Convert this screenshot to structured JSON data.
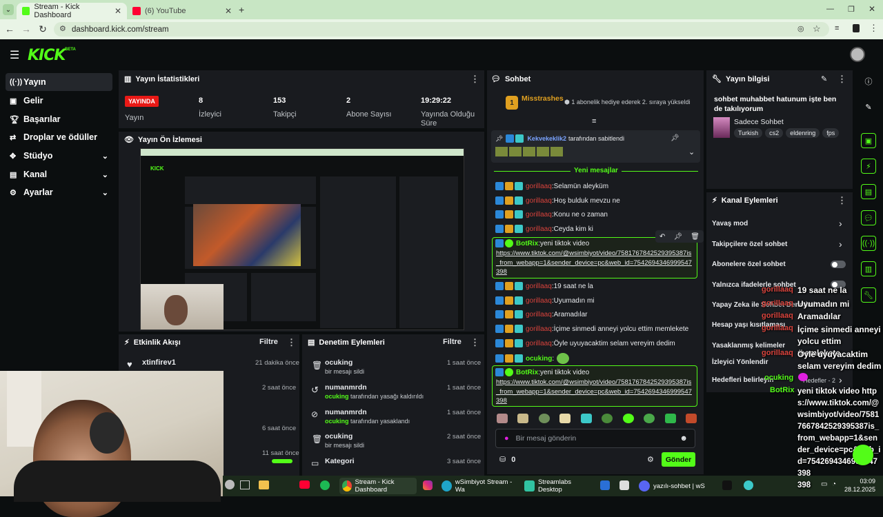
{
  "browser": {
    "tabs": [
      {
        "title": "Stream - Kick Dashboard",
        "active": true
      },
      {
        "title": "(6) YouTube",
        "active": false
      }
    ],
    "url": "dashboard.kick.com/stream"
  },
  "kick": {
    "logo": "KICK",
    "beta": "BETA"
  },
  "nav": [
    {
      "label": "Yayın",
      "icon": "broadcast-icon",
      "active": true
    },
    {
      "label": "Gelir",
      "icon": "money-icon"
    },
    {
      "label": "Başarılar",
      "icon": "trophy-icon"
    },
    {
      "label": "Droplar ve ödüller",
      "icon": "gift-icon"
    },
    {
      "label": "Stüdyo",
      "icon": "studio-icon",
      "expand": true
    },
    {
      "label": "Kanal",
      "icon": "channel-icon",
      "expand": true
    },
    {
      "label": "Ayarlar",
      "icon": "settings-icon",
      "expand": true
    }
  ],
  "stats": {
    "title": "Yayın İstatistikleri",
    "live_badge": "YAYINDA",
    "live_label": "Yayın",
    "items": [
      {
        "value": "8",
        "label": "İzleyici"
      },
      {
        "value": "153",
        "label": "Takipçi"
      },
      {
        "value": "2",
        "label": "Abone Sayısı"
      },
      {
        "value": "19:29:22",
        "label": "Yayında Olduğu Süre"
      }
    ]
  },
  "preview": {
    "title": "Yayın Ön İzlemesi"
  },
  "activity": {
    "title": "Etkinlik Akışı",
    "filter": "Filtre",
    "items": [
      {
        "user": "xtinfirev1",
        "time": "21 dakika önce",
        "sub": "kanalı takip etti"
      },
      {
        "time": "2 saat önce"
      },
      {
        "time": "6 saat önce"
      },
      {
        "time": "11 saat önce"
      }
    ]
  },
  "moderation": {
    "title": "Denetim Eylemleri",
    "filter": "Filtre",
    "items": [
      {
        "user": "ocuking",
        "time": "1 saat önce",
        "desc": "bir mesajı sildi",
        "actor": ""
      },
      {
        "user": "numanmrdn",
        "time": "1 saat önce",
        "actor": "ocuking",
        "desc": "tarafından yasağı kaldırıldı"
      },
      {
        "user": "numanmrdn",
        "time": "1 saat önce",
        "actor": "ocuking",
        "desc": "tarafından yasaklandı"
      },
      {
        "user": "ocuking",
        "time": "2 saat önce",
        "desc": "bir mesajı sildi",
        "actor": ""
      },
      {
        "user": "Kategori",
        "time": "3 saat önce",
        "desc": "",
        "actor": ""
      }
    ]
  },
  "chat": {
    "title": "Sohbet",
    "top_gifter": "Misstrashes",
    "top_gifter_count": "1",
    "top_gifter_note": "1 abonelik hediye ederek 2. sıraya yükseldi",
    "pinned_by_user": "Kekvekeklik2",
    "pinned_by_text": "tarafından sabitlendi",
    "new_messages": "Yeni mesajlar",
    "messages": [
      {
        "user": "gorillaaq",
        "text": "Selamün aleyküm"
      },
      {
        "user": "gorillaaq",
        "text": "Hoş bulduk mevzu ne"
      },
      {
        "user": "gorillaaq",
        "text": "Konu ne o zaman"
      },
      {
        "user": "gorillaaq",
        "text": "Ceyda kim ki"
      },
      {
        "user": "BotRix",
        "text": "yeni tiktok video",
        "link": "https://www.tiktok.com/@wsimbiyot/video/7581767842529395387is_from_webapp=1&sender_device=pc&web_id=7542694346999547 398"
      },
      {
        "user": "gorillaaq",
        "text": "19 saat ne la"
      },
      {
        "user": "gorillaaq",
        "text": "Uyumadın mi"
      },
      {
        "user": "gorillaaq",
        "text": "Aramadılar"
      },
      {
        "user": "gorillaaq",
        "text": "İçime sinmedi anneyi yolcu ettim memlekete"
      },
      {
        "user": "gorillaaq",
        "text": "Öyle uyuyacaktim selam vereyim dedim"
      },
      {
        "user": "ocuking",
        "text": ""
      },
      {
        "user": "BotRix",
        "text": "yeni tiktok video",
        "link": "https://www.tiktok.com/@wsimbiyot/video/7581767842529395387is_from_webapp=1&sender_device=pc&web_id=7542694346999547 398"
      }
    ],
    "input_placeholder": "Bir mesaj gönderin",
    "kicks_count": "0",
    "send": "Gönder"
  },
  "stream_info": {
    "title": "Yayın bilgisi",
    "stream_title": "sohbet muhabbet hatunum işte ben de takılıyorum",
    "category": "Sadece Sohbet",
    "tags": [
      "Turkish",
      "cs2",
      "eldenring",
      "fps"
    ]
  },
  "channel_actions": {
    "title": "Kanal Eylemleri",
    "items": [
      {
        "label": "Yavaş mod",
        "kind": "arrow"
      },
      {
        "label": "Takipçilere özel sohbet",
        "kind": "arrow"
      },
      {
        "label": "Abonelere özel sohbet",
        "kind": "toggle"
      },
      {
        "label": "Yalnızca ifadelerle sohbet",
        "kind": "toggle"
      },
      {
        "label": "Yapay Zeka ile Sohbet Denetimi",
        "kind": "arrow"
      },
      {
        "label": "Hesap yaşı kısıtlaması",
        "kind": "arrow"
      },
      {
        "label": "Yasaklanmış kelimeler",
        "kind": "arrow"
      },
      {
        "label": "İzleyici Yönlendir",
        "kind": "arrow"
      },
      {
        "label": "Hedefleri belirleyin",
        "kind": "arrow",
        "extra": "Hedefler - 2"
      }
    ]
  },
  "overlay": {
    "lines": [
      {
        "user": "gorillaaq",
        "text": "19 saat ne la"
      },
      {
        "user": "gorillaaq",
        "text": "Uyumadın mi"
      },
      {
        "user": "gorillaaq",
        "text": "Aramadılar"
      },
      {
        "user": "gorillaaq",
        "text": "İçime sinmedi anneyi yolcu ettim memlekete"
      },
      {
        "user": "gorillaaq",
        "text": "Öyle uyuyacaktim selam vereyim dedim"
      },
      {
        "user": "ocuking",
        "text": ""
      },
      {
        "user": "BotRix",
        "text": "yeni tiktok video https://www.tiktok.com/@wsimbiyot/video/75817667842529395387is_from_webapp=1&sender_device=pc&web_id=7542694346999547 398"
      }
    ]
  },
  "taskbar": {
    "apps": [
      "Stream - Kick Dashboard",
      "wSimbiyot Stream - Wa",
      "Streamlabs Desktop",
      "yazılı-sohbet | wS"
    ],
    "time": "03:09",
    "date": "28.12.2025"
  },
  "colors": {
    "accent": "#53fc18",
    "panel": "#191b1f",
    "bg": "#0b0e0f",
    "live": "#e91916",
    "username": "#d9433c"
  }
}
